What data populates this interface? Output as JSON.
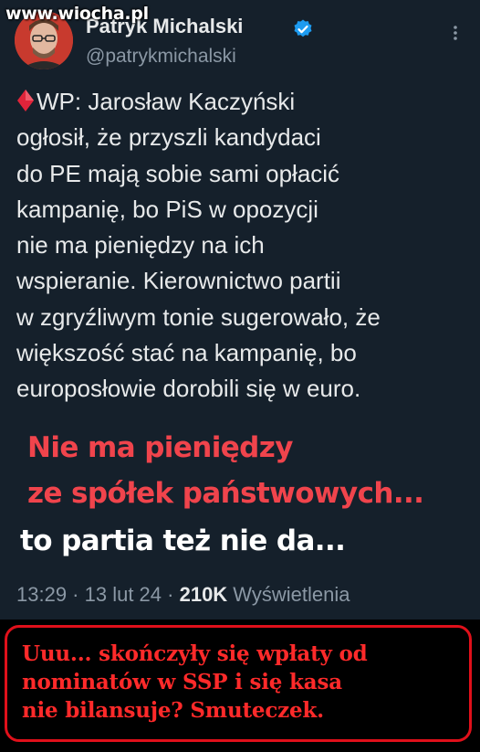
{
  "watermark": "www.wiocha.pl",
  "author": {
    "display_name": "Patryk Michalski",
    "handle": "@patrykmichalski",
    "avatar_icon": "profile-photo",
    "verified_icon": "verified-badge-icon"
  },
  "tweet_lines": [
    "WP: Jarosław Kaczyński",
    "ogłosił, że przyszli kandydaci",
    "do PE mają sobie sami opłacić",
    "kampanię, bo PiS w opozycji",
    "nie ma pieniędzy na ich",
    "wspieranie. Kierownictwo partii",
    "w zgryźliwym tonie sugerowało, że",
    "większość stać na kampanię, bo",
    "europosłowie dorobili się w euro."
  ],
  "overlay": {
    "line1": "Nie ma pieniędzy",
    "line2": "ze spółek państwowych...",
    "line3": "to partia też nie da...",
    "accent_color": "#f0444c",
    "white_color": "#ffffff"
  },
  "meta": {
    "time": "13:29",
    "sep1": " · ",
    "date": "13 lut 24",
    "sep2": " · ",
    "views": "210K",
    "views_label": " Wyświetlenia"
  },
  "caption_lines": [
    "Uuu... skończyły się wpłaty od",
    "nominatów w SSP i się kasa",
    "nie bilansuje? Smuteczek."
  ],
  "colors": {
    "tweet_bg": "#15202b",
    "text": "#e7e9ea",
    "secondary": "#8b98a5",
    "verified": "#1d9bf0",
    "caption_red": "#ff2a2a"
  }
}
